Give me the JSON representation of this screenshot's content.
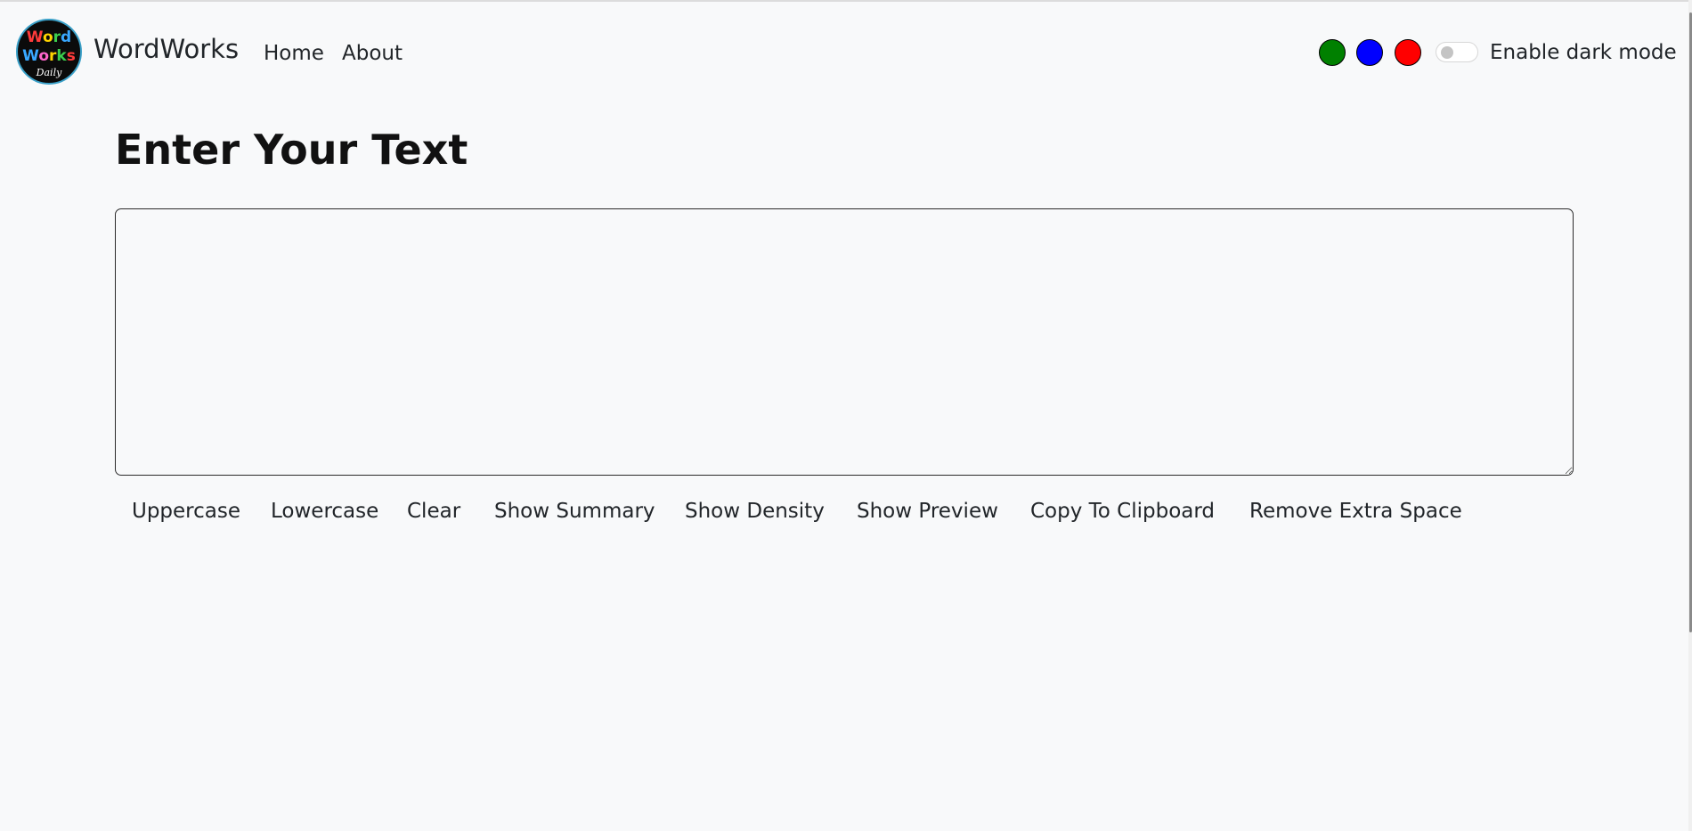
{
  "navbar": {
    "logo": {
      "line1": "Word",
      "line2": "Works",
      "line3": "Daily",
      "colors": [
        "#ff3b3b",
        "#ffd400",
        "#3ccf4e",
        "#39a8ff",
        "#ff66cc",
        "#ffffff"
      ]
    },
    "brand": "WordWorks",
    "links": [
      {
        "label": "Home"
      },
      {
        "label": "About"
      }
    ],
    "theme_swatches": [
      {
        "name": "green",
        "color": "#008000"
      },
      {
        "name": "blue",
        "color": "#0000ff"
      },
      {
        "name": "red",
        "color": "#ff0000"
      }
    ],
    "dark_mode": {
      "label": "Enable dark mode",
      "enabled": false
    }
  },
  "main": {
    "heading": "Enter Your Text",
    "textarea": {
      "value": "",
      "placeholder": ""
    },
    "buttons": [
      {
        "label": "Uppercase"
      },
      {
        "label": "Lowercase"
      },
      {
        "label": "Clear"
      },
      {
        "label": "Show Summary"
      },
      {
        "label": "Show Density"
      },
      {
        "label": "Show Preview"
      },
      {
        "label": "Copy To Clipboard"
      },
      {
        "label": "Remove Extra Space"
      }
    ]
  }
}
